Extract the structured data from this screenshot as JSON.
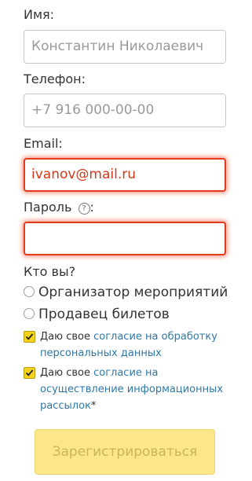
{
  "form": {
    "name": {
      "label": "Имя:",
      "placeholder": "Константин Николаевич"
    },
    "phone": {
      "label": "Телефон:",
      "placeholder": "+7 916 000-00-00"
    },
    "email": {
      "label": "Email:",
      "value": "ivanov@mail.ru"
    },
    "password": {
      "label_text": "Пароль",
      "help_glyph": "?",
      "label_suffix": ":",
      "value": ""
    },
    "role": {
      "label": "Кто вы?",
      "options": [
        {
          "label": "Организатор мероприятий"
        },
        {
          "label": "Продавец билетов"
        }
      ]
    },
    "consents": [
      {
        "prefix": "Даю свое ",
        "link": "согласие на обработку персональных данных",
        "suffix": "",
        "checked": true
      },
      {
        "prefix": "Даю свое ",
        "link": "согласие на осуществление информационных рассылок",
        "suffix": "*",
        "checked": true
      }
    ],
    "submit_label": "Зарегистрироваться"
  },
  "colors": {
    "error": "#e23b1e",
    "accent": "#f5d31c",
    "link": "#2e78a8",
    "button_bg": "#fbe78a"
  },
  "icons": {
    "help": "question-circle-icon",
    "check": "checkmark-icon"
  }
}
